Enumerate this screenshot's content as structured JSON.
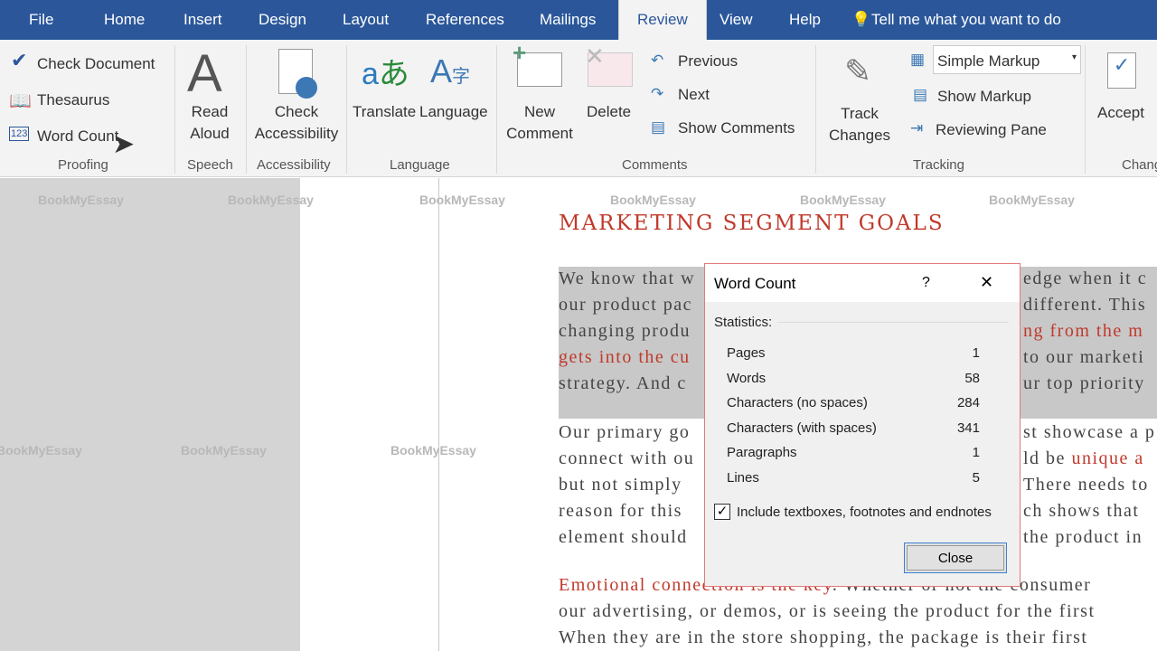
{
  "tabs": [
    "File",
    "Home",
    "Insert",
    "Design",
    "Layout",
    "References",
    "Mailings",
    "Review",
    "View",
    "Help"
  ],
  "tell_me": "Tell me what you want to do",
  "ribbon": {
    "proofing": {
      "check_document": "Check Document",
      "thesaurus": "Thesaurus",
      "word_count": "Word Count",
      "label": "Proofing"
    },
    "speech": {
      "read_aloud": [
        "Read",
        "Aloud"
      ],
      "label": "Speech"
    },
    "accessibility": {
      "check": [
        "Check",
        "Accessibility"
      ],
      "label": "Accessibility"
    },
    "language": {
      "translate": "Translate",
      "language": "Language",
      "label": "Language"
    },
    "comments": {
      "new": [
        "New",
        "Comment"
      ],
      "delete": "Delete",
      "previous": "Previous",
      "next": "Next",
      "show": "Show Comments",
      "label": "Comments"
    },
    "tracking": {
      "track": [
        "Track",
        "Changes"
      ],
      "markup_select": "Simple Markup",
      "show_markup": "Show Markup",
      "reviewing_pane": "Reviewing Pane",
      "label": "Tracking"
    },
    "changes": {
      "accept": "Accept",
      "label": "Chang"
    }
  },
  "watermark": "BookMyEssay",
  "document": {
    "heading": "MARKETING SEGMENT GOALS",
    "lines": [
      {
        "left": "We know that w",
        "right": "edge when it c"
      },
      {
        "left": "our product pac",
        "right": "different. This"
      },
      {
        "left": "changing produ",
        "right": "ng from the m",
        "right_red": true
      },
      {
        "left": "gets into the cu",
        "left_red": true,
        "right": "to our marketi"
      },
      {
        "left": "strategy. And c",
        "right": "ur top priority"
      },
      {
        "left": "Our primary go",
        "right": "st showcase a p"
      },
      {
        "left": "connect with ou",
        "right": "ld be ",
        "right_red_part": "unique a"
      },
      {
        "left": "but not simply",
        "right": "There needs to"
      },
      {
        "left": "reason for this",
        "right": "ch shows that"
      },
      {
        "left": "element should",
        "right": "the product in"
      }
    ],
    "para3": [
      {
        "red": "Emotional connection is the key",
        "text": ". Whether or not the consumer"
      },
      {
        "text": "our advertising, or demos, or is seeing the product for the first"
      },
      {
        "text": "When they are in the store shopping, the package is their first"
      }
    ]
  },
  "dialog": {
    "title": "Word Count",
    "help": "?",
    "close_x": "✕",
    "statistics": "Statistics:",
    "rows": [
      [
        "Pages",
        "1"
      ],
      [
        "Words",
        "58"
      ],
      [
        "Characters (no spaces)",
        "284"
      ],
      [
        "Characters (with spaces)",
        "341"
      ],
      [
        "Paragraphs",
        "1"
      ],
      [
        "Lines",
        "5"
      ]
    ],
    "include_label": "Include textboxes, footnotes and endnotes",
    "include_checked": true,
    "close_button": "Close"
  }
}
